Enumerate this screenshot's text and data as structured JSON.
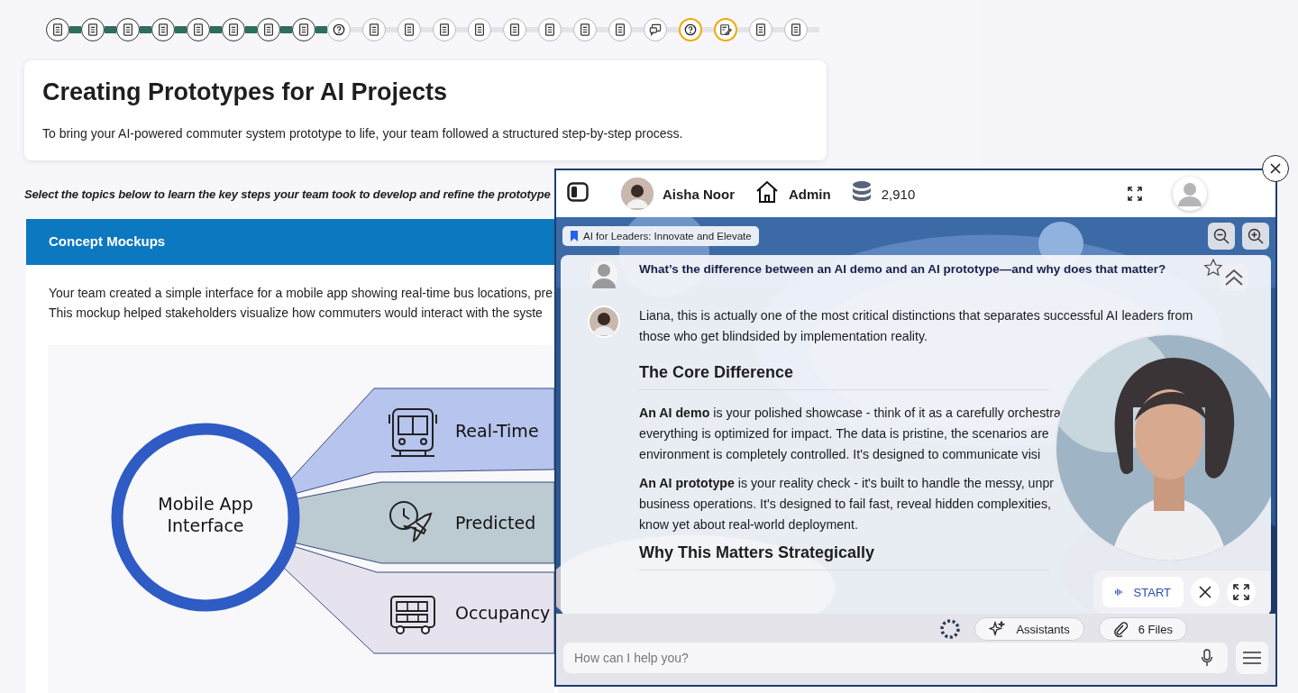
{
  "progress": {
    "steps": [
      {
        "kind": "document",
        "completed": true,
        "highlighted": false
      },
      {
        "kind": "document",
        "completed": true,
        "highlighted": false
      },
      {
        "kind": "document",
        "completed": true,
        "highlighted": false
      },
      {
        "kind": "document",
        "completed": true,
        "highlighted": false
      },
      {
        "kind": "document",
        "completed": true,
        "highlighted": false
      },
      {
        "kind": "document",
        "completed": true,
        "highlighted": false
      },
      {
        "kind": "document",
        "completed": true,
        "highlighted": false
      },
      {
        "kind": "document",
        "completed": true,
        "highlighted": false
      },
      {
        "kind": "question",
        "completed": false,
        "highlighted": false
      },
      {
        "kind": "document",
        "completed": false,
        "highlighted": false
      },
      {
        "kind": "document",
        "completed": false,
        "highlighted": false
      },
      {
        "kind": "document",
        "completed": false,
        "highlighted": false
      },
      {
        "kind": "document",
        "completed": false,
        "highlighted": false
      },
      {
        "kind": "document",
        "completed": false,
        "highlighted": false
      },
      {
        "kind": "document",
        "completed": false,
        "highlighted": false
      },
      {
        "kind": "document",
        "completed": false,
        "highlighted": false
      },
      {
        "kind": "document",
        "completed": false,
        "highlighted": false
      },
      {
        "kind": "chat",
        "completed": false,
        "highlighted": false
      },
      {
        "kind": "question",
        "completed": false,
        "highlighted": true
      },
      {
        "kind": "edit",
        "completed": false,
        "highlighted": true
      },
      {
        "kind": "document",
        "completed": false,
        "highlighted": false
      },
      {
        "kind": "document",
        "completed": false,
        "highlighted": false
      }
    ]
  },
  "intro_card": {
    "title": "Creating Prototypes for AI Projects",
    "text": "To bring your AI-powered commuter system prototype to life, your team followed a structured step-by-step process."
  },
  "instruction": "Select the topics below to learn the key steps your team took to develop and refine the prototype",
  "accordion": {
    "title": "Concept Mockups",
    "body_lines": [
      "Your team created a simple interface for a mobile app showing real-time bus locations, pre",
      "This mockup helped stakeholders visualize how commuters would interact with the syste"
    ],
    "diagram": {
      "center_label_lines": [
        "Mobile App",
        "Interface"
      ],
      "items": [
        {
          "label": "Real-Time",
          "color": "#b6c4ee"
        },
        {
          "label": "Predicted",
          "color": "#bccad2"
        },
        {
          "label": "Occupancy",
          "color": "#e6e3ef"
        }
      ]
    }
  },
  "chat_window": {
    "header": {
      "user_name": "Aisha Noor",
      "role": "Admin",
      "credits": "2,910"
    },
    "course_chip": "AI for Leaders: Innovate and Elevate",
    "messages": [
      {
        "kind": "question",
        "text": "What’s the difference between an AI demo and an AI prototype—and why does that matter?"
      },
      {
        "kind": "answer",
        "blocks": [
          {
            "kind": "paragraph",
            "lines": [
              "Liana, this is actually one of the most critical distinctions that separates successful AI leaders from",
              "those who get blindsided by implementation reality."
            ]
          },
          {
            "kind": "heading",
            "text": "The Core Difference"
          },
          {
            "kind": "paragraph",
            "lines": [
              "**An AI demo** is your polished showcase - think of it as a carefully orchestra",
              "everything is optimized for impact. The data is pristine, the scenarios are",
              "environment is completely controlled. It's designed to communicate visi"
            ]
          },
          {
            "kind": "paragraph",
            "lines": [
              "**An AI prototype** is your reality check - it's built to handle the messy, unpr",
              "business operations. It's designed to fail fast, reveal hidden complexities,",
              "know yet about real-world deployment."
            ]
          },
          {
            "kind": "heading",
            "text": "Why This Matters Strategically"
          }
        ]
      }
    ],
    "voice": {
      "start_label": "START"
    },
    "toolbar": {
      "assistants": "Assistants",
      "files": "6 Files"
    },
    "input": {
      "placeholder": "How can I help you?"
    }
  }
}
